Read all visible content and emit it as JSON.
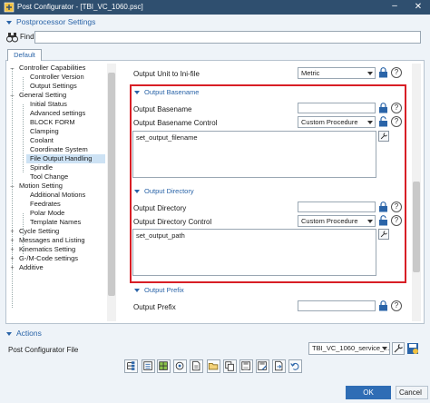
{
  "window": {
    "title": "Post Configurator - [TBI_VC_1060.psc]",
    "minimize": "–",
    "close": "✕"
  },
  "section_title": "Postprocessor Settings",
  "find": {
    "label": "Find",
    "value": ""
  },
  "tab": {
    "label": "Default"
  },
  "tree": {
    "items": [
      {
        "label": "Controller Capabilities",
        "expander": "–"
      },
      {
        "label": "Controller Version"
      },
      {
        "label": "Output Settings"
      },
      {
        "label": "General Setting",
        "expander": "–"
      },
      {
        "label": "Initial Status"
      },
      {
        "label": "Advanced settings"
      },
      {
        "label": "BLOCK FORM"
      },
      {
        "label": "Clamping"
      },
      {
        "label": "Coolant"
      },
      {
        "label": "Coordinate System"
      },
      {
        "label": "File Output Handling"
      },
      {
        "label": "Spindle"
      },
      {
        "label": "Tool Change"
      },
      {
        "label": "Motion Setting",
        "expander": "–"
      },
      {
        "label": "Additional Motions"
      },
      {
        "label": "Feedrates"
      },
      {
        "label": "Polar Mode"
      },
      {
        "label": "Template Names"
      },
      {
        "label": "Cycle Setting",
        "expander": "+"
      },
      {
        "label": "Messages and Listing",
        "expander": "+"
      },
      {
        "label": "Kinematics Setting",
        "expander": "+"
      },
      {
        "label": "G-/M-Code settings",
        "expander": "+"
      },
      {
        "label": "Additive",
        "expander": "+"
      }
    ]
  },
  "right_panel": {
    "output_unit": {
      "label": "Output Unit to Ini-file",
      "value": "Metric"
    },
    "output_basename": {
      "header": "Output Basename",
      "field_label": "Output Basename",
      "field_value": "",
      "control_label": "Output Basename Control",
      "control_value": "Custom Procedure",
      "procedure": "set_output_filename"
    },
    "output_directory": {
      "header": "Output Directory",
      "field_label": "Output Directory",
      "field_value": "",
      "control_label": "Output Directory Control",
      "control_value": "Custom Procedure",
      "procedure": "set_output_path"
    },
    "output_prefix": {
      "header": "Output Prefix",
      "field_label": "Output Prefix"
    },
    "help_glyph": "?"
  },
  "actions": {
    "header": "Actions",
    "pcf_label": "Post Configurator File",
    "pcf_value": "TBI_VC_1060_service_..."
  },
  "footer": {
    "ok": "OK",
    "cancel": "Cancel"
  },
  "colors": {
    "accent": "#2a64a8",
    "titlebar": "#2f4f6f",
    "highlight": "#d81f26",
    "ok_button": "#2f6db5",
    "selection": "#cde2f4"
  }
}
